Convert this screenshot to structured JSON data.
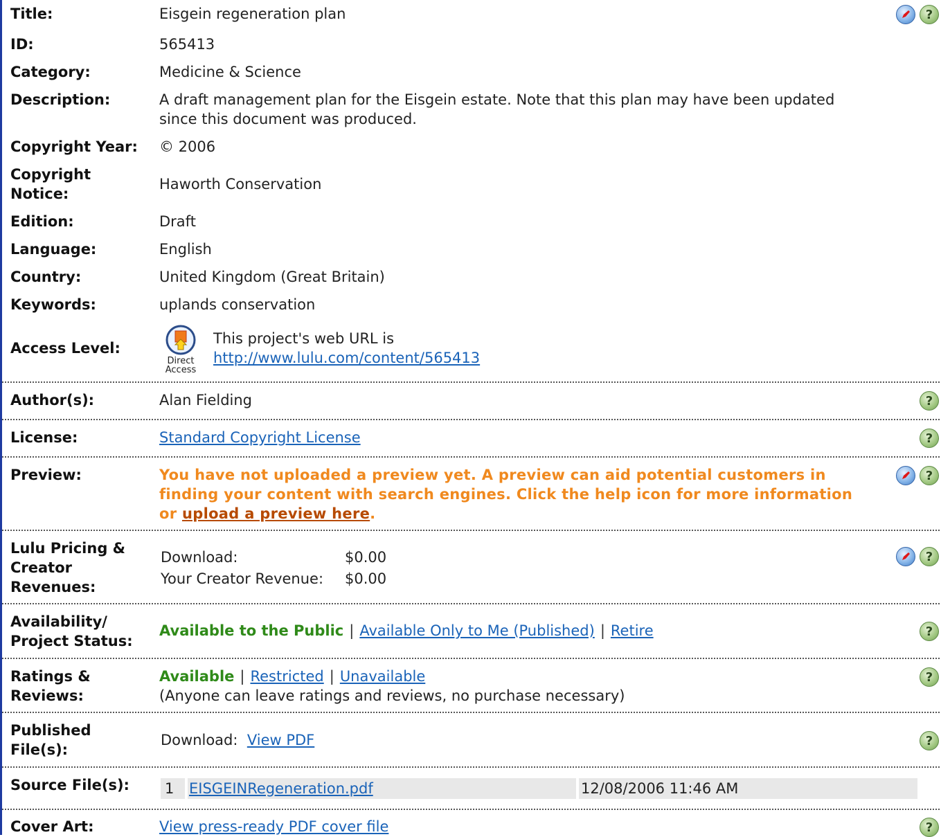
{
  "title": {
    "label": "Title:",
    "value": "Eisgein regeneration plan"
  },
  "id": {
    "label": "ID:",
    "value": "565413"
  },
  "category": {
    "label": "Category:",
    "value": "Medicine & Science"
  },
  "description": {
    "label": "Description:",
    "line1": "A draft management plan for the Eisgein estate. Note that this plan may have been updated",
    "line2": "since this document was produced."
  },
  "copyright_year": {
    "label": "Copyright Year:",
    "value": "© 2006"
  },
  "copyright_notice": {
    "label1": "Copyright",
    "label2": "Notice:",
    "value": "Haworth Conservation"
  },
  "edition": {
    "label": "Edition:",
    "value": "Draft"
  },
  "language": {
    "label": "Language:",
    "value": "English"
  },
  "country": {
    "label": "Country:",
    "value": "United Kingdom (Great Britain)"
  },
  "keywords": {
    "label": "Keywords:",
    "value": "uplands conservation"
  },
  "access_level": {
    "label": "Access Level:",
    "icon_caption1": "Direct",
    "icon_caption2": "Access",
    "text": "This project's web URL is",
    "url": "http://www.lulu.com/content/565413"
  },
  "authors": {
    "label": "Author(s):",
    "value": "Alan Fielding"
  },
  "license": {
    "label": "License:",
    "link": "Standard Copyright License"
  },
  "preview": {
    "label": "Preview:",
    "line1": "You have not uploaded a preview yet. A preview can aid potential customers in",
    "line2": "finding your content with search engines. Click the help icon for more information",
    "line3_prefix": "or ",
    "link": "upload a preview here",
    "line3_suffix": "."
  },
  "pricing": {
    "label1": "Lulu Pricing &",
    "label2": "Creator",
    "label3": "Revenues:",
    "download_label": "Download:",
    "download_value": "$0.00",
    "revenue_label": "Your Creator Revenue:",
    "revenue_value": "$0.00"
  },
  "availability": {
    "label1": "Availability/",
    "label2": "Project Status:",
    "current": "Available to the Public",
    "opt1": "Available Only to Me (Published)",
    "opt2": "Retire"
  },
  "ratings": {
    "label1": "Ratings &",
    "label2": "Reviews:",
    "current": "Available",
    "opt1": "Restricted",
    "opt2": "Unavailable",
    "note": "(Anyone can leave ratings and reviews, no purchase necessary)"
  },
  "published": {
    "label1": "Published",
    "label2": "File(s):",
    "download_label": "Download:",
    "link": "View PDF"
  },
  "source": {
    "label": "Source File(s):",
    "num": "1",
    "file": "EISGEINRegeneration.pdf",
    "date": "12/08/2006 11:46 AM"
  },
  "cover": {
    "label": "Cover Art:",
    "link": "View press-ready PDF cover file"
  },
  "icons": {
    "help": "help-icon",
    "edit": "edit-icon",
    "help_glyph": "?"
  },
  "colors": {
    "link": "#1a63b8",
    "warning": "#f0891e",
    "status_green": "#2f8a19",
    "border": "#1e3aa0"
  }
}
